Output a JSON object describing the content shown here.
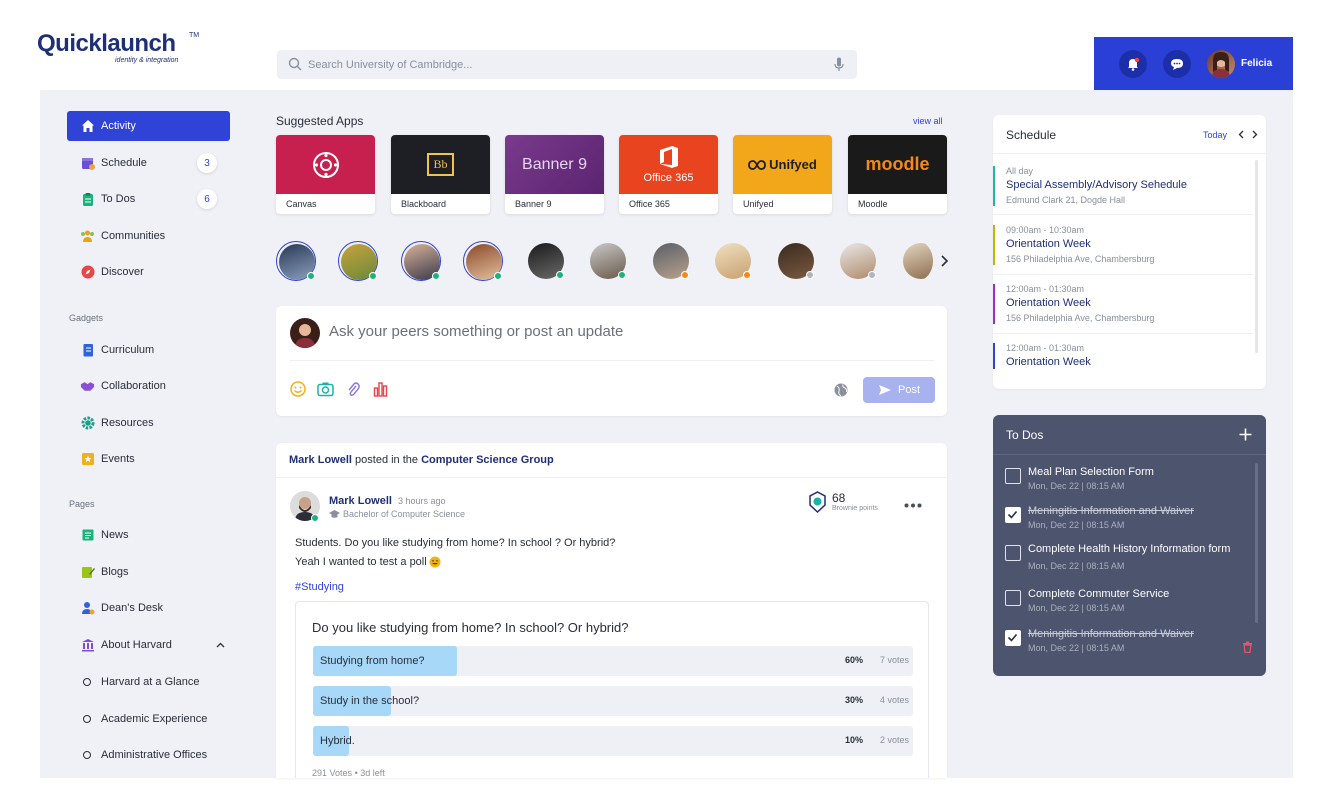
{
  "brand": {
    "name": "Quicklaunch",
    "tm": "TM",
    "tagline": "identity & integration"
  },
  "search": {
    "placeholder": "Search University of Cambridge..."
  },
  "user": {
    "name": "Felicia"
  },
  "sidebar": {
    "items": [
      {
        "label": "Activity"
      },
      {
        "label": "Schedule",
        "badge": "3"
      },
      {
        "label": "To Dos",
        "badge": "6"
      },
      {
        "label": "Communities"
      },
      {
        "label": "Discover"
      }
    ],
    "gadgets_heading": "Gadgets",
    "gadgets": [
      {
        "label": "Curriculum"
      },
      {
        "label": "Collaboration"
      },
      {
        "label": "Resources"
      },
      {
        "label": "Events"
      }
    ],
    "pages_heading": "Pages",
    "pages": [
      {
        "label": "News"
      },
      {
        "label": "Blogs"
      },
      {
        "label": "Dean's Desk"
      },
      {
        "label": "About Harvard"
      }
    ],
    "subpages": [
      {
        "label": "Harvard at a Glance"
      },
      {
        "label": "Academic Experience"
      },
      {
        "label": "Administrative Offices"
      }
    ]
  },
  "apps": {
    "title": "Suggested Apps",
    "view_all": "view all",
    "items": [
      {
        "label": "Canvas",
        "color": "#c8204e",
        "text": ""
      },
      {
        "label": "Blackboard",
        "color": "#1d1f24",
        "text": "Bb"
      },
      {
        "label": "Banner 9",
        "color": "#6a2a7c",
        "text": "Banner 9"
      },
      {
        "label": "Office 365",
        "color": "#e8441f",
        "text": "Office 365"
      },
      {
        "label": "Unifyed",
        "color": "#f2a71b",
        "text": "Unifyed"
      },
      {
        "label": "Moodle",
        "color": "#1a1a1a",
        "text": "moodle"
      }
    ]
  },
  "composer": {
    "placeholder": "Ask your peers something or post an update",
    "post_label": "Post"
  },
  "feed": {
    "author": "Mark Lowell",
    "posted_in": "posted in the",
    "group": "Computer Science Group",
    "time": "3 hours ago",
    "program": "Bachelor of Computer Science",
    "points": "68",
    "points_label": "Brownie points",
    "text1": "Students. Do you like studying from home? In school ? Or hybrid?",
    "text2": "Yeah I wanted to test a poll",
    "hashtag": "#Studying",
    "poll": {
      "question": "Do you like studying from home? In school? Or hybrid?",
      "options": [
        {
          "label": "Studying from home?",
          "pct": "60%",
          "votes": "7 votes",
          "fraction": 0.24
        },
        {
          "label": "Study in the school?",
          "pct": "30%",
          "votes": "4 votes",
          "fraction": 0.13
        },
        {
          "label": "Hybrid.",
          "pct": "10%",
          "votes": "2 votes",
          "fraction": 0.06
        }
      ],
      "footer": "291 Votes",
      "left": "3d left"
    }
  },
  "schedule": {
    "title": "Schedule",
    "today": "Today",
    "items": [
      {
        "time": "All day",
        "title": "Special Assembly/Advisory Sehedule",
        "sub": "Edmund Clark 21, Dogde Hall",
        "color": "#1bb7a6"
      },
      {
        "time": "09:00am - 10:30am",
        "title": "Orientation Week",
        "sub": "156 Philadelphia Ave, Chambersburg",
        "color": "#c6b400"
      },
      {
        "time": "12:00am - 01:30am",
        "title": "Orientation Week",
        "sub": "156 Philadelphia Ave, Chambersburg",
        "color": "#9b2ec4"
      },
      {
        "time": "12:00am - 01:30am",
        "title": "Orientation Week",
        "sub": "",
        "color": "#2f43d6"
      }
    ]
  },
  "todos": {
    "title": "To Dos",
    "items": [
      {
        "title": "Meal Plan Selection Form",
        "date": "Mon, Dec 22  |  08:15 AM",
        "done": false
      },
      {
        "title": "Meningitis Information and Waiver",
        "date": "Mon, Dec 22  |  08:15 AM",
        "done": true
      },
      {
        "title": "Complete Health History Information form",
        "date": "Mon, Dec 22  |  08:15 AM",
        "done": false
      },
      {
        "title": "Complete Commuter Service",
        "date": "Mon, Dec 22  |  08:15 AM",
        "done": false
      },
      {
        "title": "Meningitis Information and Waiver",
        "date": "Mon, Dec 22  |  08:15 AM",
        "done": true
      }
    ]
  },
  "colors": {
    "accent": "#2f43d6",
    "header": "#2a3fd6",
    "todo_bg": "#4d546e"
  }
}
